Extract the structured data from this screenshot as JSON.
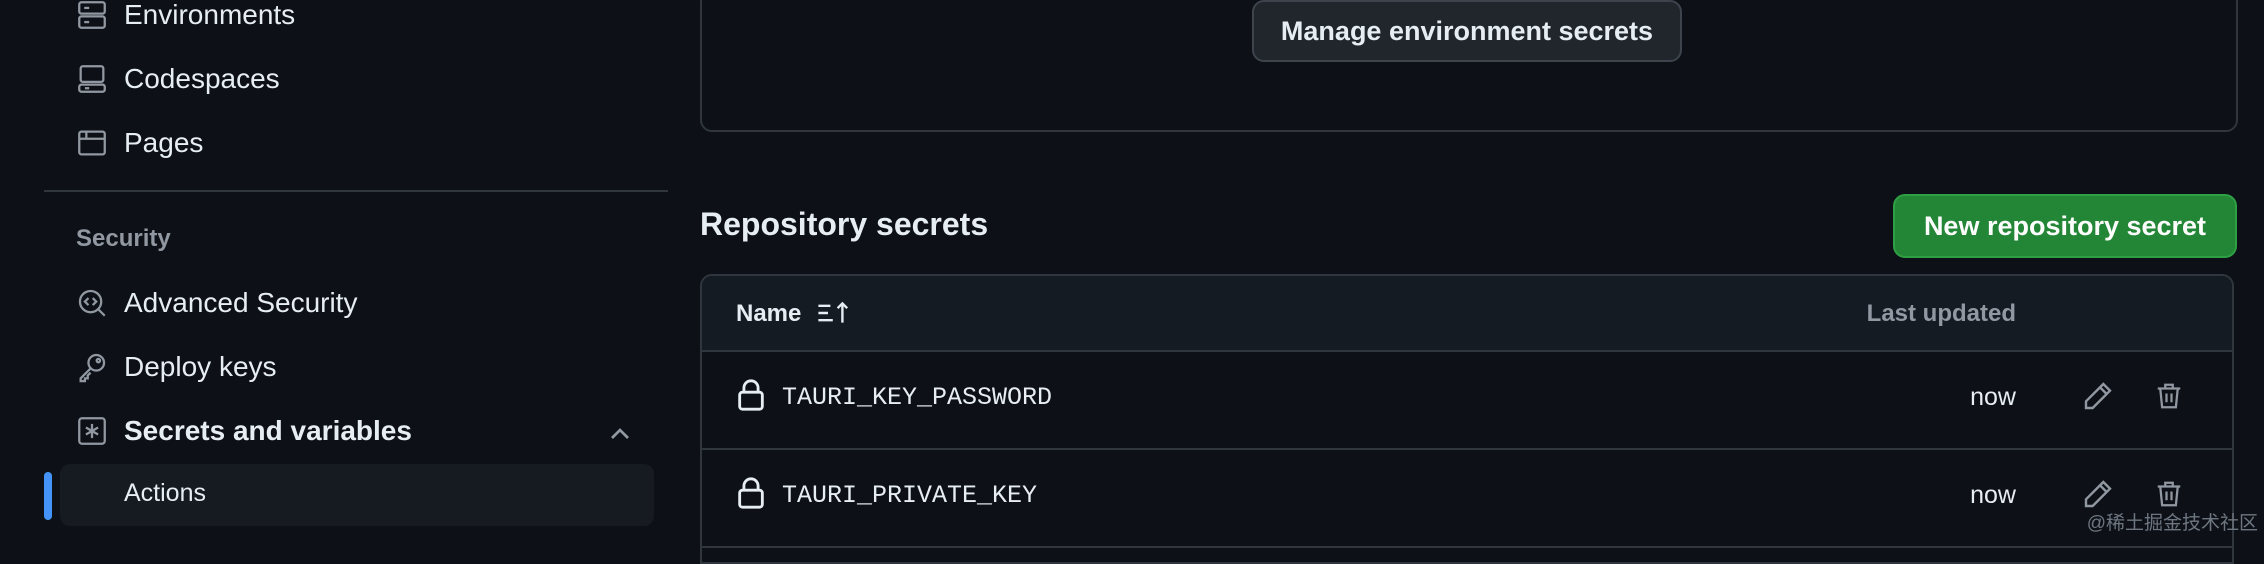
{
  "sidebar": {
    "items": [
      {
        "label": "Environments",
        "icon": "server-icon"
      },
      {
        "label": "Codespaces",
        "icon": "codespaces-icon"
      },
      {
        "label": "Pages",
        "icon": "browser-icon"
      }
    ],
    "security_heading": "Security",
    "security_items": [
      {
        "label": "Advanced Security",
        "icon": "codescan-icon"
      },
      {
        "label": "Deploy keys",
        "icon": "key-icon"
      },
      {
        "label": "Secrets and variables",
        "icon": "asterisk-icon"
      }
    ],
    "sub_items": [
      {
        "label": "Actions",
        "active": true
      }
    ]
  },
  "environment": {
    "manage_button": "Manage environment secrets"
  },
  "repository_secrets": {
    "title": "Repository secrets",
    "new_button": "New repository secret",
    "columns": {
      "name": "Name",
      "last_updated": "Last updated"
    },
    "rows": [
      {
        "name": "TAURI_KEY_PASSWORD",
        "updated": "now"
      },
      {
        "name": "TAURI_PRIVATE_KEY",
        "updated": "now"
      }
    ]
  },
  "watermark": "@稀土掘金技术社区",
  "colors": {
    "accent": "#4493f8",
    "primary_button": "#238636",
    "background": "#0d1117"
  }
}
